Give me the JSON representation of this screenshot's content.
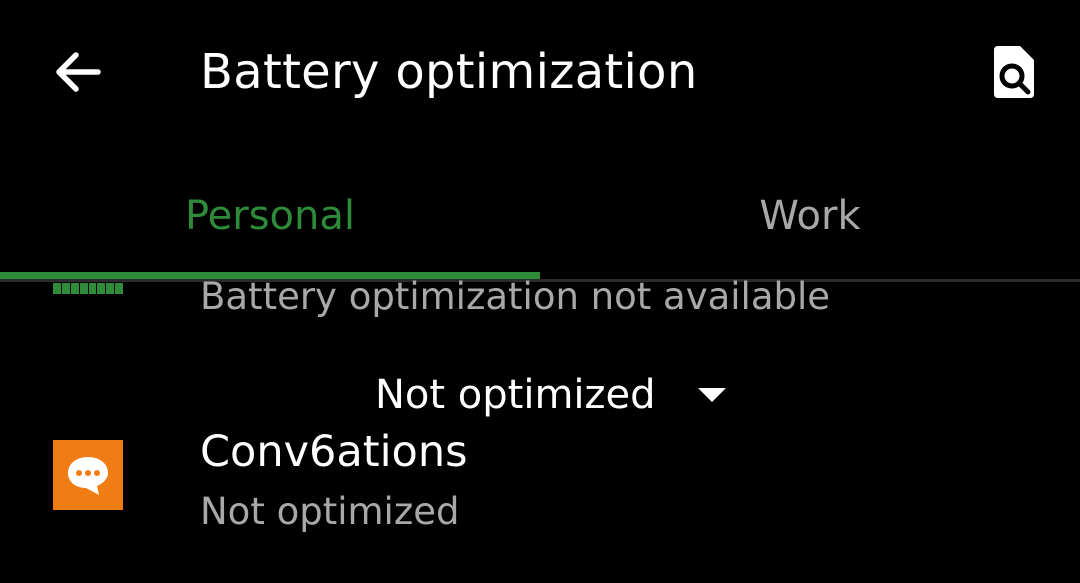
{
  "colors": {
    "background": "#000000",
    "text_primary": "#ffffff",
    "text_secondary": "#a8a8a8",
    "accent": "#2e8b3a",
    "app_icon_bg": "#f07c14"
  },
  "header": {
    "back_icon": "arrow-left-icon",
    "title": "Battery optimization",
    "search_icon": "search-in-page-icon"
  },
  "tabs": [
    {
      "label": "Personal",
      "selected": true
    },
    {
      "label": "Work",
      "selected": false
    }
  ],
  "list": {
    "partial_item": {
      "icon": "battery-app-icon",
      "subtitle": "Battery optimization not available"
    },
    "filter": {
      "selected": "Not optimized",
      "icon": "dropdown-arrow-icon"
    },
    "items": [
      {
        "icon": "chat-bubble-icon",
        "name": "Conv6ations",
        "status": "Not optimized"
      }
    ]
  }
}
